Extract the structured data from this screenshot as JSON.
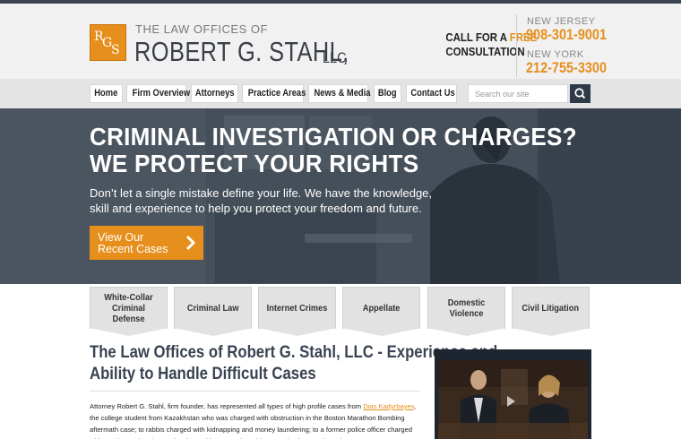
{
  "header": {
    "logo": {
      "letters": [
        "R",
        "G",
        "S"
      ]
    },
    "firm_prefix": "THE LAW OFFICES OF",
    "firm_name": "ROBERT G. STAHL,",
    "firm_suffix": "LLC",
    "cta_line1": "CALL FOR A",
    "cta_highlight": "FREE",
    "cta_line2": "CONSULTATION",
    "phones": [
      {
        "region": "NEW JERSEY",
        "number": "908-301-9001"
      },
      {
        "region": "NEW YORK",
        "number": "212-755-3300"
      }
    ]
  },
  "nav": {
    "items": [
      "Home",
      "Firm Overview",
      "Attorneys",
      "Practice Areas",
      "News & Media",
      "Blog",
      "Contact Us"
    ],
    "search_placeholder": "Search our site"
  },
  "hero": {
    "headline_line1": "CRIMINAL INVESTIGATION OR CHARGES?",
    "headline_line2": "WE PROTECT YOUR RIGHTS",
    "subtext": "Don’t let a single mistake define your life. We have the knowledge, skill and experience to help you protect your freedom and future.",
    "button_line1": "View Our",
    "button_line2": "Recent Cases"
  },
  "practice_tabs": [
    "White-Collar Criminal Defense",
    "Criminal Law",
    "Internet Crimes",
    "Appellate",
    "Domestic Violence",
    "Civil Litigation"
  ],
  "content": {
    "title_line1": "The Law Offices of Robert G. Stahl, LLC - Experience and",
    "title_line2": "Ability to Handle Difficult Cases",
    "body_part1": "Attorney Robert G. Stahl, firm founder, has represented all types of high profile cases from",
    "body_link": "Dias Kadyrbayev",
    "body_part2": ", the college student from Kazakhstan who was charged with obstruction in the Boston Marathon Bombing aftermath case; to rabbis charged with kidnapping and money laundering; to a former police officer charged with murder; and a pharmacist charged in connection with a massive internet-based"
  },
  "colors": {
    "accent": "#e68f1c",
    "dark": "#3a3f47",
    "hero_bg": "#4a545f",
    "nav_bg": "#e4e4e4"
  }
}
